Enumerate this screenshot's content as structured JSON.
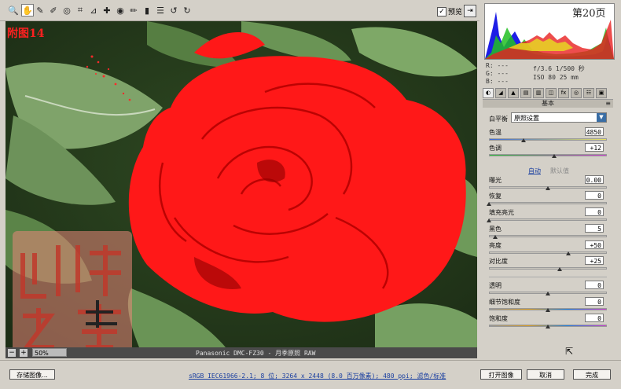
{
  "page_marker": "附图14",
  "page_number": "第20页",
  "toolbar": {
    "tools": [
      {
        "icon": "zoom-icon",
        "glyph": "🔍"
      },
      {
        "icon": "hand-icon",
        "glyph": "✋",
        "active": true
      },
      {
        "icon": "eyedropper-icon",
        "glyph": "✎"
      },
      {
        "icon": "color-sampler-icon",
        "glyph": "✐"
      },
      {
        "icon": "target-adjust-icon",
        "glyph": "◎"
      },
      {
        "icon": "crop-icon",
        "glyph": "⌗"
      },
      {
        "icon": "straighten-icon",
        "glyph": "⊿"
      },
      {
        "icon": "spot-removal-icon",
        "glyph": "✚"
      },
      {
        "icon": "red-eye-icon",
        "glyph": "◉"
      },
      {
        "icon": "adjustment-brush-icon",
        "glyph": "✏"
      },
      {
        "icon": "graduated-filter-icon",
        "glyph": "▮"
      },
      {
        "icon": "preferences-icon",
        "glyph": "☰"
      },
      {
        "icon": "rotate-left-icon",
        "glyph": "↺"
      },
      {
        "icon": "rotate-right-icon",
        "glyph": "↻"
      }
    ],
    "preview_label": "预览",
    "preview_checked": "✓"
  },
  "zoom": {
    "minus": "−",
    "plus": "+",
    "level": "50%"
  },
  "camera_label": "Panasonic DMC-FZ30 - 月季原照 RAW",
  "info": {
    "r": "R:   ---",
    "g": "G:   ---",
    "b": "B:   ---",
    "exposure": "f/3.6  1/500 秒",
    "iso": "ISO 80   25 mm"
  },
  "panel_title": "基本",
  "panel_menu": "≡",
  "white_balance": {
    "label": "白平衡",
    "value": "原照设置",
    "arrow": "▼"
  },
  "sliders": [
    {
      "name": "色温",
      "value": "4850",
      "pos": 0.29
    },
    {
      "name": "色调",
      "value": "+12",
      "pos": 0.55
    },
    {
      "name": "曝光",
      "value": "0.00",
      "pos": 0.5
    },
    {
      "name": "恢复",
      "value": "0",
      "pos": 0.0
    },
    {
      "name": "填充亮光",
      "value": "0",
      "pos": 0.0
    },
    {
      "name": "黑色",
      "value": "5",
      "pos": 0.05
    },
    {
      "name": "亮度",
      "value": "+50",
      "pos": 0.67
    },
    {
      "name": "对比度",
      "value": "+25",
      "pos": 0.6
    },
    {
      "name": "透明",
      "value": "0",
      "pos": 0.5
    },
    {
      "name": "细节饱和度",
      "value": "0",
      "pos": 0.5
    },
    {
      "name": "饱和度",
      "value": "0",
      "pos": 0.5
    }
  ],
  "auto_label": "自动",
  "default_label": "默认值",
  "status_link": "sRGB IEC61966-2.1; 8 位; 3264 x 2448 (8.0 百万像素); 480 ppi; 滤色/标准",
  "buttons": {
    "save": "存储图像...",
    "open": "打开图像",
    "cancel": "取消",
    "done": "完成"
  },
  "colors": {
    "clip_red": "#ff1a1a",
    "accent": "#3a6ea5"
  }
}
